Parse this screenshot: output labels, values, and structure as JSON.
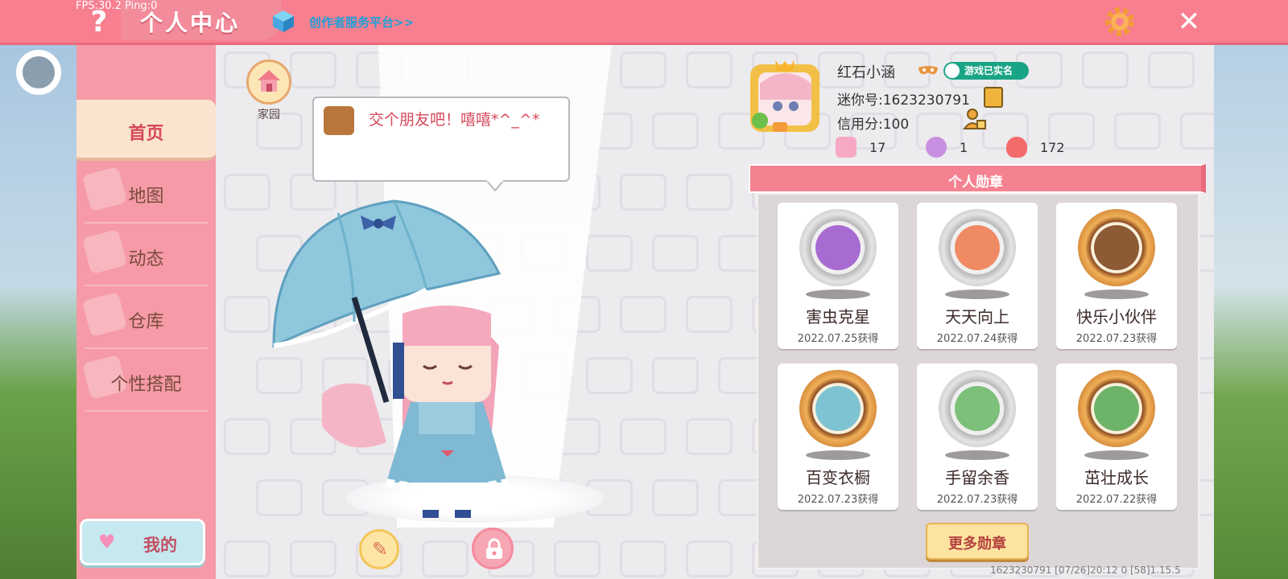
{
  "overlay": {
    "fps_text": "FPS:30.2  Ping:0"
  },
  "header": {
    "help_label": "?",
    "title": "个人中心",
    "creator_link": "创作者服务平台>>",
    "close_label": "✕"
  },
  "sidebar": {
    "items": [
      {
        "label": "首页",
        "active": true
      },
      {
        "label": "地图"
      },
      {
        "label": "动态"
      },
      {
        "label": "仓库"
      },
      {
        "label": "个性搭配"
      }
    ],
    "me_button": "我的"
  },
  "stage": {
    "home_label": "家园",
    "bubble_text": "交个朋友吧！嘻嘻*^_^*"
  },
  "profile": {
    "name": "红石小涵",
    "verified_badge": "游戏已实名",
    "mini_id": "迷你号:1623230791",
    "credit": "信用分:100",
    "stats": [
      {
        "icon": "plus-card-icon",
        "value": "17"
      },
      {
        "icon": "cheer-icon",
        "value": "1"
      },
      {
        "icon": "flame-icon",
        "value": "172"
      }
    ]
  },
  "medals": {
    "header": "个人勋章",
    "items": [
      {
        "name": "害虫克星",
        "date": "2022.07.25获得",
        "tier": "silver"
      },
      {
        "name": "天天向上",
        "date": "2022.07.24获得",
        "tier": "silver"
      },
      {
        "name": "快乐小伙伴",
        "date": "2022.07.23获得",
        "tier": "gold"
      },
      {
        "name": "百变衣橱",
        "date": "2022.07.23获得",
        "tier": "gold"
      },
      {
        "name": "手留余香",
        "date": "2022.07.23获得",
        "tier": "silver"
      },
      {
        "name": "茁壮成长",
        "date": "2022.07.22获得",
        "tier": "gold"
      }
    ],
    "more_button": "更多勋章"
  },
  "footer": {
    "info": "1623230791    [07/26]20:12 0  [58]1.15.5"
  },
  "colors": {
    "accent": "#f77f8f",
    "sidebar": "#f59aa6",
    "panel": "#ecebee"
  }
}
